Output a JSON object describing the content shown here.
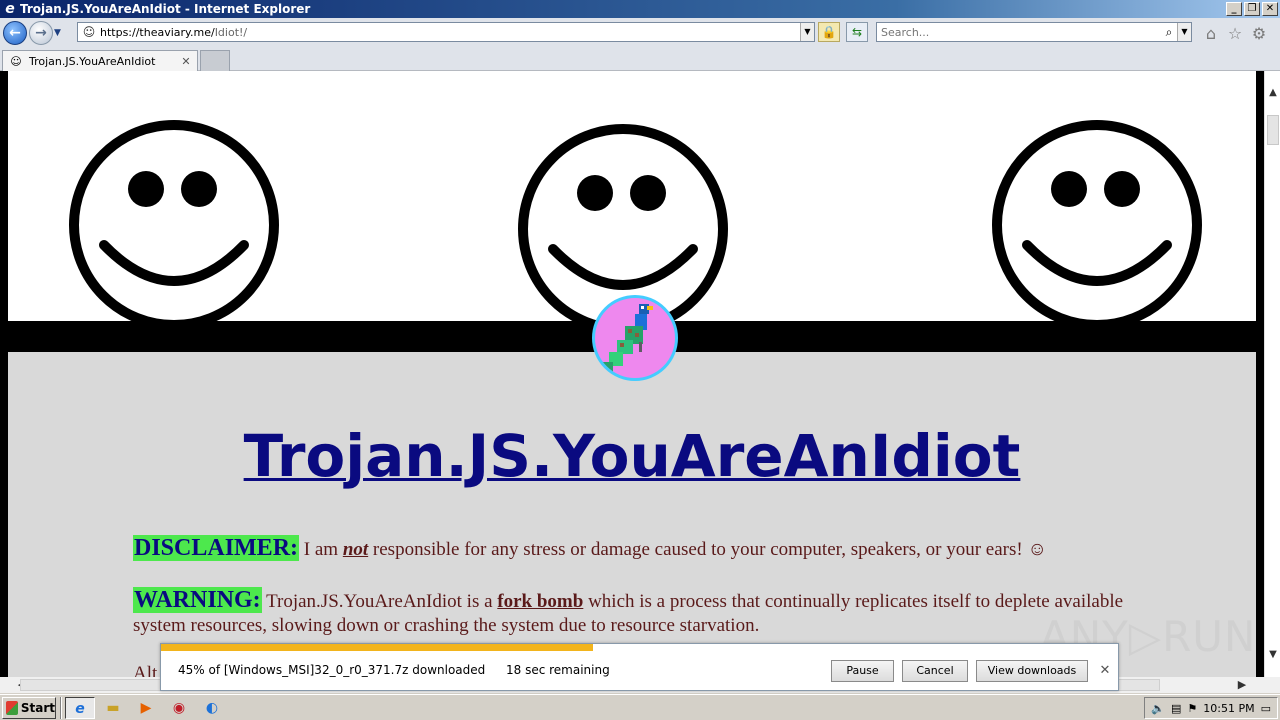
{
  "window": {
    "title": "Trojan.JS.YouAreAnIdiot - Internet Explorer",
    "buttons": [
      "_",
      "❐",
      "✕"
    ]
  },
  "address": {
    "url_host": "https://theaviary.me/",
    "url_path": "Idiot!/"
  },
  "search": {
    "placeholder": "Search..."
  },
  "tab": {
    "label": "Trojan.JS.YouAreAnIdiot"
  },
  "page": {
    "title": "Trojan.JS.YouAreAnIdiot",
    "disclaimer_label": "DISCLAIMER:",
    "disclaimer_pre": " I am ",
    "disclaimer_em": "not",
    "disclaimer_post": " responsible for any stress or damage caused to your computer, speakers, or your ears! ☺",
    "warning_label": "WARNING:",
    "warning_pre": " Trojan.JS.YouAreAnIdiot is a ",
    "warning_link": "fork bomb",
    "warning_post": " which is a process that continually replicates itself to deplete available system resources, slowing down or crashing the system due to resource starvation.",
    "partial_line": "Alt"
  },
  "download": {
    "progress_percent": 45,
    "message": "45% of [Windows_MSI]32_0_r0_371.7z downloaded",
    "remaining": "18 sec remaining",
    "pause_label": "Pause",
    "cancel_label": "Cancel",
    "view_label": "View downloads"
  },
  "watermark": "ANY▷RUN",
  "taskbar": {
    "start_label": "Start",
    "clock": "10:51 PM"
  },
  "colors": {
    "title_text": "#0a0a80",
    "highlight": "#4de84d",
    "body_text": "#5a1a1a",
    "progress": "#f2b41c"
  }
}
